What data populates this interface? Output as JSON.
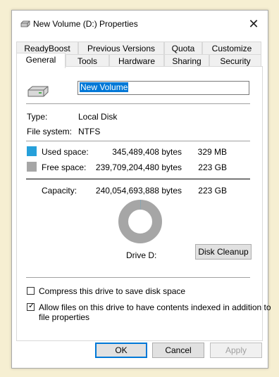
{
  "window": {
    "title": "New Volume (D:) Properties",
    "icon": "drive-icon",
    "close_glyph": "✕"
  },
  "tabs": {
    "row1": [
      "ReadyBoost",
      "Previous Versions",
      "Quota",
      "Customize"
    ],
    "row2": [
      "General",
      "Tools",
      "Hardware",
      "Sharing",
      "Security"
    ],
    "active": "General"
  },
  "general": {
    "volume_name": "New Volume",
    "type_label": "Type:",
    "type_value": "Local Disk",
    "fs_label": "File system:",
    "fs_value": "NTFS",
    "used_label": "Used space:",
    "used_bytes": "345,489,408 bytes",
    "used_size": "329 MB",
    "free_label": "Free space:",
    "free_bytes": "239,709,204,480 bytes",
    "free_size": "223 GB",
    "capacity_label": "Capacity:",
    "capacity_bytes": "240,054,693,888 bytes",
    "capacity_size": "223 GB",
    "drive_label": "Drive D:",
    "cleanup_button": "Disk Cleanup",
    "compress_label": "Compress this drive to save disk space",
    "compress_checked": false,
    "index_label_line1": "Allow files on this drive to have contents indexed in addition to",
    "index_label_line2": "file properties",
    "index_checked": true,
    "used_fraction": 0.00144,
    "colors": {
      "used": "#26a0da",
      "free": "#a6a6a6"
    }
  },
  "buttons": {
    "ok": "OK",
    "cancel": "Cancel",
    "apply": "Apply"
  }
}
